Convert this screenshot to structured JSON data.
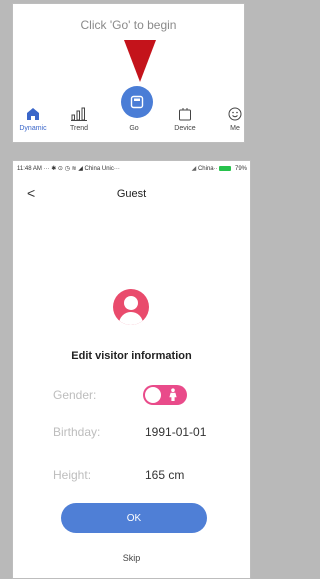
{
  "top_panel": {
    "hint": "Click 'Go' to begin",
    "nav": [
      {
        "label": "Dynamic",
        "icon": "home-icon",
        "active": true
      },
      {
        "label": "Trend",
        "icon": "trend-chart-icon",
        "active": false
      },
      {
        "label": "Go",
        "icon": "scale-icon",
        "active": false
      },
      {
        "label": "Device",
        "icon": "device-icon",
        "active": false
      },
      {
        "label": "Me",
        "icon": "smiley-icon",
        "active": false
      }
    ],
    "accent_color": "#4a7dd6",
    "arrow_color": "#c4131b"
  },
  "status_bar": {
    "time": "11:48 AM",
    "carrier1": "China Unic···",
    "carrier2": "China··",
    "battery": "79%"
  },
  "header": {
    "back": "<",
    "title": "Guest"
  },
  "form": {
    "section_title": "Edit visitor information",
    "gender_label": "Gender:",
    "gender_value": "female",
    "birthday_label": "Birthday:",
    "birthday_value": "1991-01-01",
    "height_label": "Height:",
    "height_value": "165 cm",
    "ok_label": "OK",
    "skip_label": "Skip",
    "avatar_color": "#e94b6c",
    "toggle_color": "#e94b8a",
    "button_color": "#4f7fd6"
  }
}
